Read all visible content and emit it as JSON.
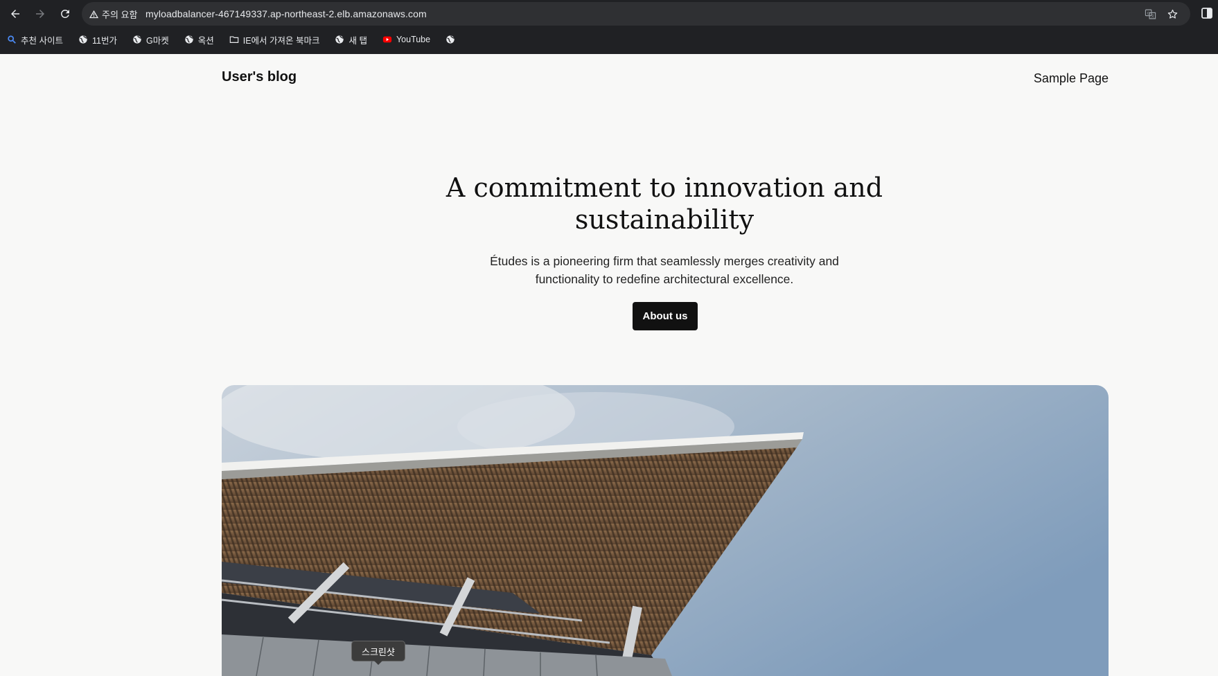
{
  "browser": {
    "security_chip": "주의 요함",
    "url": "myloadbalancer-467149337.ap-northeast-2.elb.amazonaws.com",
    "bookmarks": [
      {
        "label": "추천 사이트",
        "icon": "search-icon"
      },
      {
        "label": "11번가",
        "icon": "globe-icon"
      },
      {
        "label": "G마켓",
        "icon": "globe-icon"
      },
      {
        "label": "옥션",
        "icon": "globe-icon"
      },
      {
        "label": "IE에서 가져온 북마크",
        "icon": "folder-icon"
      },
      {
        "label": "새 탭",
        "icon": "globe-icon"
      },
      {
        "label": "YouTube",
        "icon": "youtube-icon"
      },
      {
        "label": "",
        "icon": "globe-icon"
      }
    ],
    "colors": {
      "chrome_bg": "#202124",
      "omnibox_bg": "#2f3033",
      "text": "#e8eaed"
    }
  },
  "site": {
    "title": "User's blog",
    "nav": [
      "Sample Page"
    ],
    "hero": {
      "heading": "A commitment to innovation and sustainability",
      "subtext": "Études is a pioneering firm that seamlessly merges creativity and functionality to redefine architectural excellence.",
      "button": "About us"
    },
    "image": {
      "subject": "architecture-photo"
    },
    "colors": {
      "background": "#f8f8f7",
      "text": "#111111",
      "button_bg": "#111111",
      "button_text": "#ffffff"
    }
  },
  "tooltip": {
    "text": "스크린샷"
  }
}
